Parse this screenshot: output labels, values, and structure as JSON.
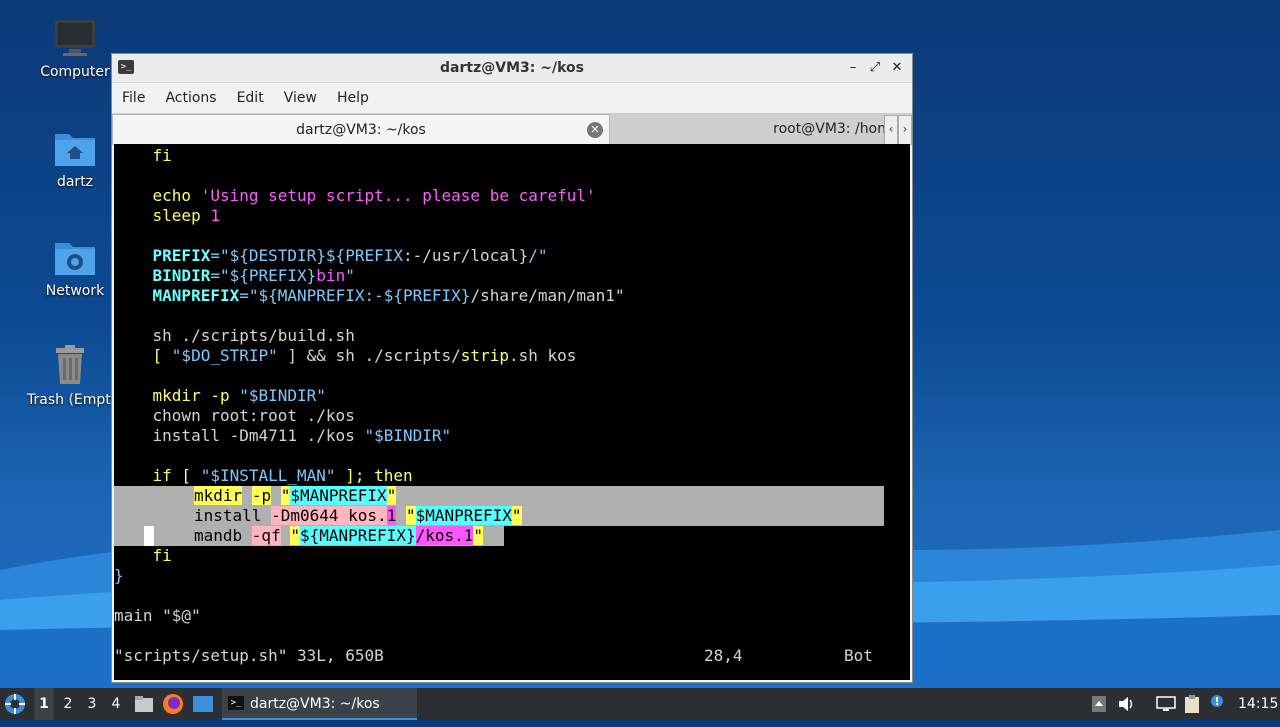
{
  "desktop": {
    "icons": [
      {
        "label": "Computer",
        "icon": "computer-icon"
      },
      {
        "label": "dartz",
        "icon": "home-folder-icon"
      },
      {
        "label": "Network",
        "icon": "network-folder-icon"
      },
      {
        "label": "Trash (Empty)",
        "icon": "trash-icon"
      }
    ]
  },
  "window": {
    "title": "dartz@VM3: ~/kos",
    "controls": [
      "–",
      "⤢",
      "✕"
    ],
    "menu": [
      "File",
      "Actions",
      "Edit",
      "View",
      "Help"
    ],
    "tabs": [
      {
        "label": "dartz@VM3: ~/kos",
        "active": true
      },
      {
        "label": "root@VM3: /hon",
        "active": false
      }
    ]
  },
  "terminal": {
    "lines": {
      "l0": "    fi",
      "l1a": "    echo ",
      "l1b": "'Using setup script... please be careful'",
      "l2a": "    sleep ",
      "l2b": "1",
      "l3a": "    PREFIX",
      "l3b": "=\"${DESTDIR}${PREFIX",
      "l3c": ":-/usr/local}",
      "l3d": "/\"",
      "l4a": "    BINDIR",
      "l4b": "=\"${PREFIX}",
      "l4c": "bin",
      "l4d": "\"",
      "l5a": "    MANPREFIX",
      "l5b": "=\"${MANPREFIX",
      "l5c": ":-${PREFIX}",
      "l5d": "/share/man/man1\"",
      "l6": "    sh ./scripts/build.sh",
      "l7a": "    [ ",
      "l7b": "\"$DO_STRIP\"",
      "l7c": " ] && sh ./scripts/",
      "l7d": "strip",
      "l7e": ".sh kos",
      "l8a": "    mkdir -p ",
      "l8b": "\"$BINDIR\"",
      "l9": "    chown root:root ./kos",
      "l10a": "    install -Dm4711 ./kos ",
      "l10b": "\"$BINDIR\"",
      "l11a": "    if [ ",
      "l11b": "\"$INSTALL_MAN\"",
      "l11c": " ]; then",
      "l12a": "mkdir",
      "l12b": "-p",
      "l12c": "\"",
      "l12d": "$MANPREFIX",
      "l12e": "\"",
      "l13a": "install ",
      "l13b": "-Dm0644 kos.",
      "l13c": "1",
      "l13d": "\"",
      "l13e": "$MANPREFIX",
      "l13f": "\"",
      "l14a": "mandb ",
      "l14b": "-qf",
      "l14c": "\"",
      "l14d": "${MANPREFIX}",
      "l14e": "/kos.1",
      "l14f": "\"",
      "l15": "    fi",
      "l16": "}",
      "l17": "main \"$@\""
    },
    "status": {
      "file": "\"scripts/setup.sh\" 33L, 650B",
      "pos": "28,4",
      "scroll": "Bot"
    }
  },
  "taskbar": {
    "workspaces": [
      "1",
      "2",
      "3",
      "4"
    ],
    "active_workspace": "1",
    "window_button": "dartz@VM3: ~/kos",
    "clock": "14:15",
    "tray_icons": [
      "up-arrow-icon",
      "volume-icon",
      "network-icon",
      "clipboard-icon",
      "update-icon"
    ]
  }
}
